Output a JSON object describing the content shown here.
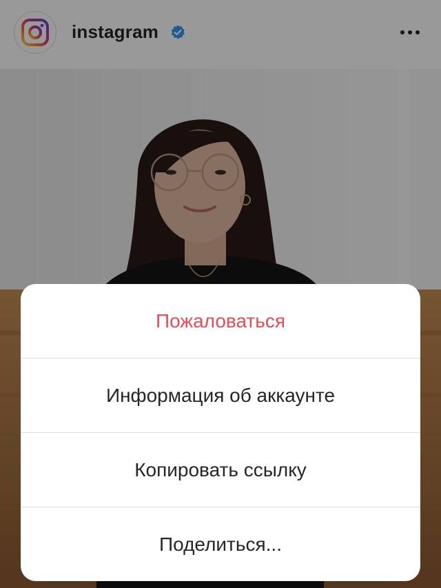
{
  "post_header": {
    "username": "instagram",
    "verified": true,
    "avatar_icon": "instagram-logo-icon",
    "more_icon": "more-horizontal-icon"
  },
  "action_sheet": {
    "items": [
      {
        "label": "Пожаловаться",
        "color": "#ed4956"
      },
      {
        "label": "Информация об аккаунте",
        "color": "#262626"
      },
      {
        "label": "Копировать ссылку",
        "color": "#262626"
      },
      {
        "label": "Поделиться...",
        "color": "#262626"
      }
    ]
  },
  "colors": {
    "verified_blue": "#3897f0",
    "danger_red": "#ed4956",
    "divider": "#dbdbdb"
  }
}
